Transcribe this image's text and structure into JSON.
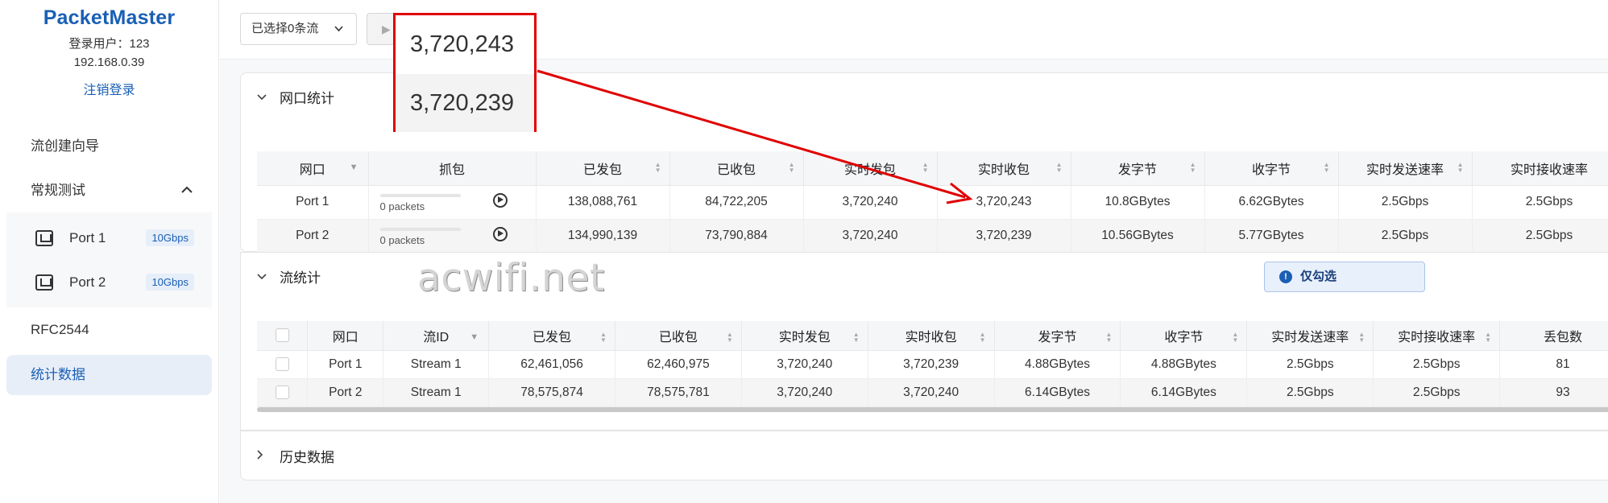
{
  "sidebar": {
    "app_name": "PacketMaster",
    "user_line": "登录用户：123",
    "ip": "192.168.0.39",
    "logout": "注销登录",
    "menu": {
      "wizard": "流创建向导",
      "regular_test": "常规测试",
      "ports": [
        {
          "label": "Port 1",
          "speed": "10Gbps"
        },
        {
          "label": "Port 2",
          "speed": "10Gbps"
        }
      ],
      "rfc2544": "RFC2544",
      "stats": "统计数据"
    }
  },
  "toolbar": {
    "selected_flows": "已选择0条流"
  },
  "port_stats": {
    "title": "网口统计",
    "columns": [
      "网口",
      "抓包",
      "已发包",
      "已收包",
      "实时发包",
      "实时收包",
      "发字节",
      "收字节",
      "实时发送速率",
      "实时接收速率"
    ],
    "rows": [
      {
        "port": "Port 1",
        "capture": "0 packets",
        "capture_progress": 0,
        "sent": "138,088,761",
        "received": "84,722,205",
        "rt_sent": "3,720,240",
        "rt_received": "3,720,243",
        "tx_bytes": "10.8GBytes",
        "rx_bytes": "6.62GBytes",
        "tx_rate": "2.5Gbps",
        "rx_rate": "2.5Gbps"
      },
      {
        "port": "Port 2",
        "capture": "0 packets",
        "capture_progress": 0,
        "sent": "134,990,139",
        "received": "73,790,884",
        "rt_sent": "3,720,240",
        "rt_received": "3,720,239",
        "tx_bytes": "10.56GBytes",
        "rx_bytes": "5.77GBytes",
        "tx_rate": "2.5Gbps",
        "rx_rate": "2.5Gbps"
      }
    ]
  },
  "flow_stats": {
    "title": "流统计",
    "notice": "仅勾选",
    "columns": [
      "网口",
      "流ID",
      "已发包",
      "已收包",
      "实时发包",
      "实时收包",
      "发字节",
      "收字节",
      "实时发送速率",
      "实时接收速率",
      "丢包数"
    ],
    "rows": [
      {
        "port": "Port 1",
        "stream": "Stream 1",
        "sent": "62,461,056",
        "received": "62,460,975",
        "rt_sent": "3,720,240",
        "rt_received": "3,720,239",
        "tx_bytes": "4.88GBytes",
        "rx_bytes": "4.88GBytes",
        "tx_rate": "2.5Gbps",
        "rx_rate": "2.5Gbps",
        "lost": "81"
      },
      {
        "port": "Port 2",
        "stream": "Stream 1",
        "sent": "78,575,874",
        "received": "78,575,781",
        "rt_sent": "3,720,240",
        "rt_received": "3,720,240",
        "tx_bytes": "6.14GBytes",
        "rx_bytes": "6.14GBytes",
        "tx_rate": "2.5Gbps",
        "rx_rate": "2.5Gbps",
        "lost": "93"
      }
    ]
  },
  "history": {
    "title": "历史数据"
  },
  "callout": {
    "value_1": "3,720,243",
    "value_2": "3,720,239",
    "color": "#e00000"
  },
  "watermark": "acwifi.net",
  "colors": {
    "brand": "#1a5fb4",
    "active_bg": "#e8eef8"
  }
}
